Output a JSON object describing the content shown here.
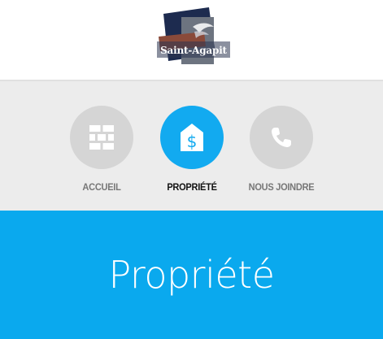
{
  "logo": {
    "text": "Saint-Agapit"
  },
  "nav": {
    "items": [
      {
        "label": "ACCUEIL",
        "icon": "brick-wall-icon",
        "active": false
      },
      {
        "label": "PROPRIÉTÉ",
        "icon": "house-dollar-icon",
        "active": true
      },
      {
        "label": "NOUS JOINDRE",
        "icon": "phone-icon",
        "active": false
      }
    ]
  },
  "banner": {
    "title": "Propriété"
  },
  "colors": {
    "accent": "#0aa9ee",
    "inactive_circle": "#d5d5d5",
    "nav_background": "#ececec"
  }
}
